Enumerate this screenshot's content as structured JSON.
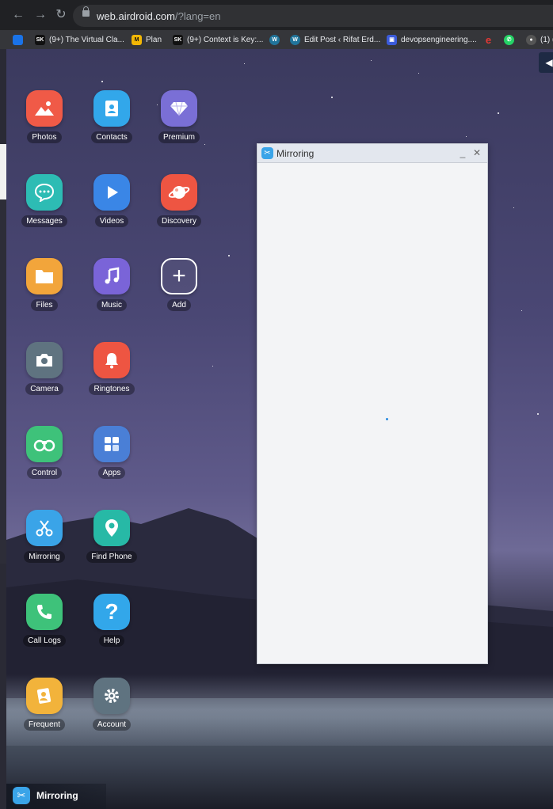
{
  "browser": {
    "url_host": "web.airdroid.com",
    "url_path": "/?lang=en",
    "bookmarks": [
      {
        "label": "",
        "icon": "cube-icon",
        "color": "#1a73e8"
      },
      {
        "label": "(9+) The Virtual Cla...",
        "icon": "sk-icon",
        "color": "#111111"
      },
      {
        "label": "Plan",
        "icon": "plan-icon",
        "color": "#f2b705"
      },
      {
        "label": "(9+) Context is Key:...",
        "icon": "sk-icon",
        "color": "#111111"
      },
      {
        "label": "",
        "icon": "wordpress-icon",
        "color": "#21759b"
      },
      {
        "label": "Edit Post ‹ Rifat Erd...",
        "icon": "wordpress-icon",
        "color": "#21759b"
      },
      {
        "label": "devopsengineering....",
        "icon": "devops-icon",
        "color": "#3b5bdb"
      },
      {
        "label": "",
        "icon": "e-icon",
        "color": "#e53935"
      },
      {
        "label": "",
        "icon": "whatsapp-icon",
        "color": "#25d366"
      },
      {
        "label": "(1) (",
        "icon": "person-icon",
        "color": "#555555"
      }
    ]
  },
  "apps": [
    {
      "label": "Photos",
      "icon": "photos-icon",
      "color": "#f05a47"
    },
    {
      "label": "Contacts",
      "icon": "contacts-icon",
      "color": "#32a7ea"
    },
    {
      "label": "Premium",
      "icon": "premium-icon",
      "color": "#7a6fd6"
    },
    {
      "label": "Messages",
      "icon": "messages-icon",
      "color": "#2dbcb4"
    },
    {
      "label": "Videos",
      "icon": "videos-icon",
      "color": "#3a86e6"
    },
    {
      "label": "Discovery",
      "icon": "discovery-icon",
      "color": "#ee5542"
    },
    {
      "label": "Files",
      "icon": "files-icon",
      "color": "#f2a53b"
    },
    {
      "label": "Music",
      "icon": "music-icon",
      "color": "#7a64d8"
    },
    {
      "label": "Add",
      "icon": "add-icon",
      "color": "transparent"
    },
    {
      "label": "Camera",
      "icon": "camera-icon",
      "color": "#5f7380"
    },
    {
      "label": "Ringtones",
      "icon": "ringtones-icon",
      "color": "#ee5542"
    },
    {
      "label": "Control",
      "icon": "control-icon",
      "color": "#3ec27a"
    },
    {
      "label": "Apps",
      "icon": "apps-icon",
      "color": "#4a7fd6"
    },
    {
      "label": "Mirroring",
      "icon": "mirroring-icon",
      "color": "#3aa4e8"
    },
    {
      "label": "Find Phone",
      "icon": "find-phone-icon",
      "color": "#27b9a6"
    },
    {
      "label": "Call Logs",
      "icon": "call-logs-icon",
      "color": "#3ec27a"
    },
    {
      "label": "Help",
      "icon": "help-icon",
      "color": "#32a7ea"
    },
    {
      "label": "Frequent",
      "icon": "frequent-icon",
      "color": "#f2b33b"
    },
    {
      "label": "Account",
      "icon": "account-icon",
      "color": "#5f7380"
    }
  ],
  "mirror_window": {
    "title": "Mirroring"
  },
  "taskbar": {
    "label": "Mirroring",
    "icon": "mirroring-icon"
  }
}
